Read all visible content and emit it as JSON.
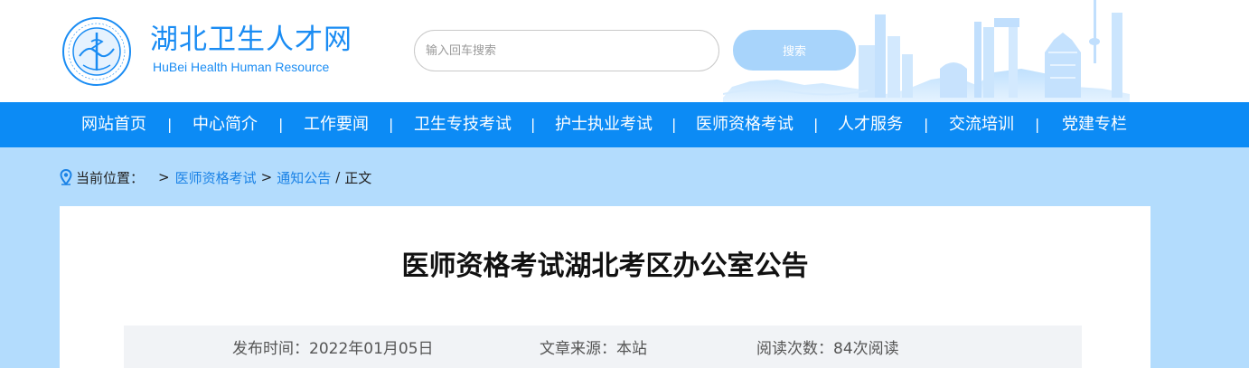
{
  "header": {
    "site_name": "湖北卫生人才网",
    "site_subtitle": "HuBei Health Human Resource",
    "logo_icon": "emblem-icon",
    "brand_color": "#1a8cf3"
  },
  "search": {
    "placeholder": "输入回车搜索",
    "value": "",
    "button_label": "搜索"
  },
  "nav": {
    "background": "#0c8bf5",
    "items": [
      {
        "label": "网站首页"
      },
      {
        "label": "中心简介"
      },
      {
        "label": "工作要闻"
      },
      {
        "label": "卫生专技考试"
      },
      {
        "label": "护士执业考试"
      },
      {
        "label": "医师资格考试"
      },
      {
        "label": "人才服务"
      },
      {
        "label": "交流培训"
      },
      {
        "label": "党建专栏"
      }
    ],
    "separator": "|"
  },
  "breadcrumb": {
    "icon": "location-pin-icon",
    "label": "当前位置：",
    "arrow": ">",
    "items": [
      {
        "label": "医师资格考试"
      },
      {
        "label": "通知公告"
      },
      {
        "label": "正文"
      }
    ],
    "separator_1": ">",
    "separator_2": "/"
  },
  "article": {
    "title": "医师资格考试湖北考区办公室公告",
    "publish_time": "发布时间：2022年01月05日",
    "source": "文章来源：本站",
    "views": "阅读次数：84次阅读"
  }
}
